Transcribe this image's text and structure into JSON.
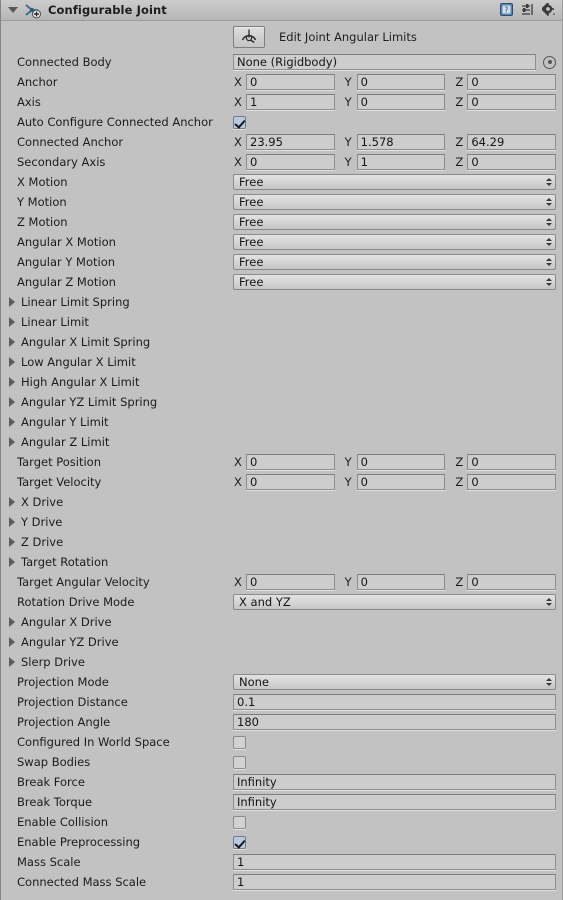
{
  "header": {
    "title": "Configurable Joint",
    "foldout_icon": "triangle-down-icon",
    "component_icon": "configurable-joint-icon",
    "icons": [
      {
        "name": "help-icon",
        "glyph": "?"
      },
      {
        "name": "preset-icon",
        "glyph": "preset"
      },
      {
        "name": "gear-icon",
        "glyph": "gear"
      }
    ]
  },
  "edit_mode": {
    "icon": "joint-angular-limits-icon",
    "label": "Edit Joint Angular Limits"
  },
  "axes": {
    "x": "X",
    "y": "Y",
    "z": "Z"
  },
  "colors": {
    "background": "#c2c2c2",
    "field_bg": "#cdcdcd",
    "field_border": "#8e8e8e",
    "checkbox_on": "#b9c9de",
    "text": "#1c1c1c"
  },
  "rows": [
    {
      "type": "object",
      "label": "Connected Body",
      "value": "None (Rigidbody)",
      "picker": "object-picker-icon"
    },
    {
      "type": "vector3",
      "label": "Anchor",
      "x": "0",
      "y": "0",
      "z": "0"
    },
    {
      "type": "vector3",
      "label": "Axis",
      "x": "1",
      "y": "0",
      "z": "0"
    },
    {
      "type": "checkbox",
      "label": "Auto Configure Connected Anchor",
      "checked": true
    },
    {
      "type": "vector3",
      "label": "Connected Anchor",
      "x": "23.95",
      "y": "1.578",
      "z": "64.29"
    },
    {
      "type": "vector3",
      "label": "Secondary Axis",
      "x": "0",
      "y": "1",
      "z": "0"
    },
    {
      "type": "popup",
      "label": "X Motion",
      "value": "Free"
    },
    {
      "type": "popup",
      "label": "Y Motion",
      "value": "Free"
    },
    {
      "type": "popup",
      "label": "Z Motion",
      "value": "Free"
    },
    {
      "type": "popup",
      "label": "Angular X Motion",
      "value": "Free"
    },
    {
      "type": "popup",
      "label": "Angular Y Motion",
      "value": "Free"
    },
    {
      "type": "popup",
      "label": "Angular Z Motion",
      "value": "Free"
    },
    {
      "type": "foldout",
      "label": "Linear Limit Spring",
      "expanded": false
    },
    {
      "type": "foldout",
      "label": "Linear Limit",
      "expanded": false
    },
    {
      "type": "foldout",
      "label": "Angular X Limit Spring",
      "expanded": false
    },
    {
      "type": "foldout",
      "label": "Low Angular X Limit",
      "expanded": false
    },
    {
      "type": "foldout",
      "label": "High Angular X Limit",
      "expanded": false
    },
    {
      "type": "foldout",
      "label": "Angular YZ Limit Spring",
      "expanded": false
    },
    {
      "type": "foldout",
      "label": "Angular Y Limit",
      "expanded": false
    },
    {
      "type": "foldout",
      "label": "Angular Z Limit",
      "expanded": false
    },
    {
      "type": "vector3",
      "label": "Target Position",
      "x": "0",
      "y": "0",
      "z": "0"
    },
    {
      "type": "vector3",
      "label": "Target Velocity",
      "x": "0",
      "y": "0",
      "z": "0"
    },
    {
      "type": "foldout",
      "label": "X Drive",
      "expanded": false
    },
    {
      "type": "foldout",
      "label": "Y Drive",
      "expanded": false
    },
    {
      "type": "foldout",
      "label": "Z Drive",
      "expanded": false
    },
    {
      "type": "foldout",
      "label": "Target Rotation",
      "expanded": false
    },
    {
      "type": "vector3",
      "label": "Target Angular Velocity",
      "x": "0",
      "y": "0",
      "z": "0"
    },
    {
      "type": "popup",
      "label": "Rotation Drive Mode",
      "value": "X and YZ"
    },
    {
      "type": "foldout",
      "label": "Angular X Drive",
      "expanded": false
    },
    {
      "type": "foldout",
      "label": "Angular YZ Drive",
      "expanded": false
    },
    {
      "type": "foldout",
      "label": "Slerp Drive",
      "expanded": false
    },
    {
      "type": "popup",
      "label": "Projection Mode",
      "value": "None"
    },
    {
      "type": "text",
      "label": "Projection Distance",
      "value": "0.1"
    },
    {
      "type": "text",
      "label": "Projection Angle",
      "value": "180"
    },
    {
      "type": "checkbox",
      "label": "Configured In World Space",
      "checked": false
    },
    {
      "type": "checkbox",
      "label": "Swap Bodies",
      "checked": false
    },
    {
      "type": "text",
      "label": "Break Force",
      "value": "Infinity"
    },
    {
      "type": "text",
      "label": "Break Torque",
      "value": "Infinity"
    },
    {
      "type": "checkbox",
      "label": "Enable Collision",
      "checked": false
    },
    {
      "type": "checkbox",
      "label": "Enable Preprocessing",
      "checked": true
    },
    {
      "type": "text",
      "label": "Mass Scale",
      "value": "1"
    },
    {
      "type": "text",
      "label": "Connected Mass Scale",
      "value": "1"
    }
  ]
}
